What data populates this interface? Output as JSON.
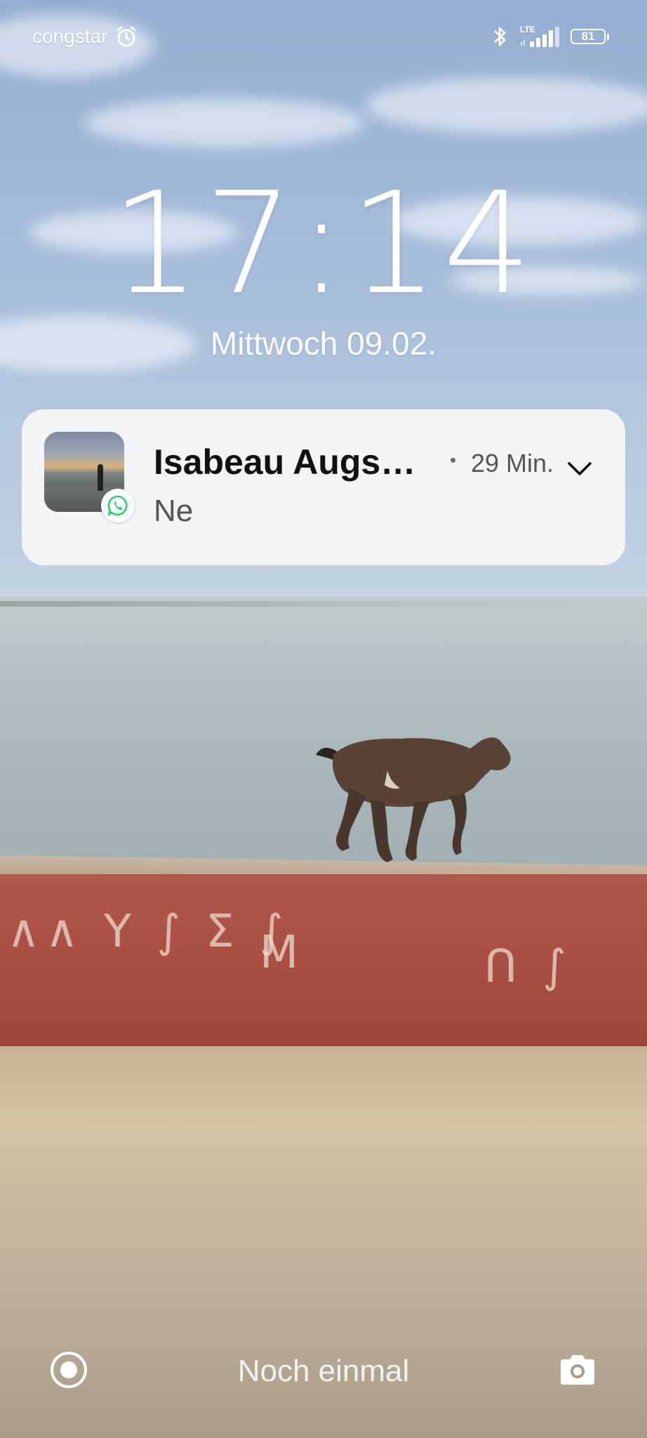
{
  "status_bar": {
    "carrier": "congstar",
    "network_label": "LTE",
    "battery": "81",
    "icons": [
      "alarm-icon",
      "bluetooth-icon",
      "signal-icon",
      "battery-icon"
    ]
  },
  "lock_screen": {
    "time": "17:14",
    "date": "Mittwoch 09.02."
  },
  "notification": {
    "title": "Isabeau Augs…",
    "time": "29 Min.",
    "message": "Ne",
    "app_icon": "whatsapp-icon",
    "accent_color": "#25D366"
  },
  "bottom_bar": {
    "hint": "Noch einmal",
    "left_icon": "target-icon",
    "right_icon": "camera-icon"
  }
}
